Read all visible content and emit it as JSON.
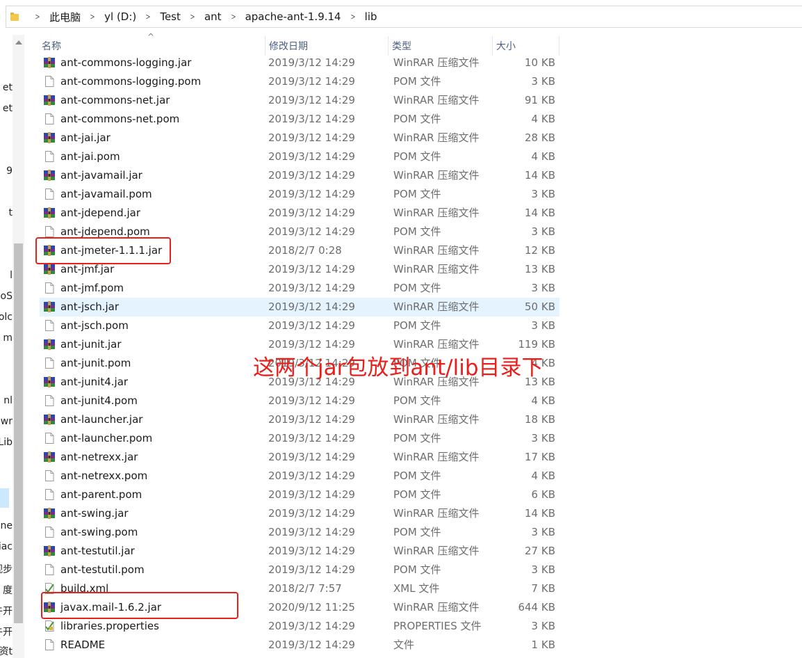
{
  "breadcrumb": [
    "此电脑",
    "yl (D:)",
    "Test",
    "ant",
    "apache-ant-1.9.14",
    "lib"
  ],
  "nav_fragments": [
    "et",
    "et",
    "9",
    "t",
    "l",
    "oS",
    "olc",
    "m",
    "nl",
    "wr",
    "Lib",
    "ne",
    "iac",
    "视步",
    "度",
    "牛开",
    "牛开",
    "资t"
  ],
  "columns": {
    "name": "名称",
    "date": "修改日期",
    "type": "类型",
    "size": "大小"
  },
  "files": [
    {
      "name": "ant-commons-logging.jar",
      "date": "2019/3/12 14:29",
      "type": "WinRAR 压缩文件",
      "size": "10 KB",
      "icon": "winrar-archive-icon"
    },
    {
      "name": "ant-commons-logging.pom",
      "date": "2019/3/12 14:29",
      "type": "POM 文件",
      "size": "3 KB",
      "icon": "generic-file-icon"
    },
    {
      "name": "ant-commons-net.jar",
      "date": "2019/3/12 14:29",
      "type": "WinRAR 压缩文件",
      "size": "91 KB",
      "icon": "winrar-archive-icon"
    },
    {
      "name": "ant-commons-net.pom",
      "date": "2019/3/12 14:29",
      "type": "POM 文件",
      "size": "4 KB",
      "icon": "generic-file-icon"
    },
    {
      "name": "ant-jai.jar",
      "date": "2019/3/12 14:29",
      "type": "WinRAR 压缩文件",
      "size": "28 KB",
      "icon": "winrar-archive-icon"
    },
    {
      "name": "ant-jai.pom",
      "date": "2019/3/12 14:29",
      "type": "POM 文件",
      "size": "4 KB",
      "icon": "generic-file-icon"
    },
    {
      "name": "ant-javamail.jar",
      "date": "2019/3/12 14:29",
      "type": "WinRAR 压缩文件",
      "size": "14 KB",
      "icon": "winrar-archive-icon"
    },
    {
      "name": "ant-javamail.pom",
      "date": "2019/3/12 14:29",
      "type": "POM 文件",
      "size": "3 KB",
      "icon": "generic-file-icon"
    },
    {
      "name": "ant-jdepend.jar",
      "date": "2019/3/12 14:29",
      "type": "WinRAR 压缩文件",
      "size": "14 KB",
      "icon": "winrar-archive-icon"
    },
    {
      "name": "ant-jdepend.pom",
      "date": "2019/3/12 14:29",
      "type": "POM 文件",
      "size": "3 KB",
      "icon": "generic-file-icon"
    },
    {
      "name": "ant-jmeter-1.1.1.jar",
      "date": "2018/2/7 0:28",
      "type": "WinRAR 压缩文件",
      "size": "12 KB",
      "icon": "winrar-archive-icon"
    },
    {
      "name": "ant-jmf.jar",
      "date": "2019/3/12 14:29",
      "type": "WinRAR 压缩文件",
      "size": "13 KB",
      "icon": "winrar-archive-icon"
    },
    {
      "name": "ant-jmf.pom",
      "date": "2019/3/12 14:29",
      "type": "POM 文件",
      "size": "3 KB",
      "icon": "generic-file-icon"
    },
    {
      "name": "ant-jsch.jar",
      "date": "2019/3/12 14:29",
      "type": "WinRAR 压缩文件",
      "size": "50 KB",
      "icon": "winrar-archive-icon"
    },
    {
      "name": "ant-jsch.pom",
      "date": "2019/3/12 14:29",
      "type": "POM 文件",
      "size": "3 KB",
      "icon": "generic-file-icon"
    },
    {
      "name": "ant-junit.jar",
      "date": "2019/3/12 14:29",
      "type": "WinRAR 压缩文件",
      "size": "119 KB",
      "icon": "winrar-archive-icon"
    },
    {
      "name": "ant-junit.pom",
      "date": "2019/3/12 14:29",
      "type": "POM 文件",
      "size": "4 KB",
      "icon": "generic-file-icon"
    },
    {
      "name": "ant-junit4.jar",
      "date": "2019/3/12 14:29",
      "type": "WinRAR 压缩文件",
      "size": "13 KB",
      "icon": "winrar-archive-icon"
    },
    {
      "name": "ant-junit4.pom",
      "date": "2019/3/12 14:29",
      "type": "POM 文件",
      "size": "4 KB",
      "icon": "generic-file-icon"
    },
    {
      "name": "ant-launcher.jar",
      "date": "2019/3/12 14:29",
      "type": "WinRAR 压缩文件",
      "size": "18 KB",
      "icon": "winrar-archive-icon"
    },
    {
      "name": "ant-launcher.pom",
      "date": "2019/3/12 14:29",
      "type": "POM 文件",
      "size": "3 KB",
      "icon": "generic-file-icon"
    },
    {
      "name": "ant-netrexx.jar",
      "date": "2019/3/12 14:29",
      "type": "WinRAR 压缩文件",
      "size": "17 KB",
      "icon": "winrar-archive-icon"
    },
    {
      "name": "ant-netrexx.pom",
      "date": "2019/3/12 14:29",
      "type": "POM 文件",
      "size": "4 KB",
      "icon": "generic-file-icon"
    },
    {
      "name": "ant-parent.pom",
      "date": "2019/3/12 14:29",
      "type": "POM 文件",
      "size": "6 KB",
      "icon": "generic-file-icon"
    },
    {
      "name": "ant-swing.jar",
      "date": "2019/3/12 14:29",
      "type": "WinRAR 压缩文件",
      "size": "14 KB",
      "icon": "winrar-archive-icon"
    },
    {
      "name": "ant-swing.pom",
      "date": "2019/3/12 14:29",
      "type": "POM 文件",
      "size": "3 KB",
      "icon": "generic-file-icon"
    },
    {
      "name": "ant-testutil.jar",
      "date": "2019/3/12 14:29",
      "type": "WinRAR 压缩文件",
      "size": "27 KB",
      "icon": "winrar-archive-icon"
    },
    {
      "name": "ant-testutil.pom",
      "date": "2019/3/12 14:29",
      "type": "POM 文件",
      "size": "3 KB",
      "icon": "generic-file-icon"
    },
    {
      "name": "build.xml",
      "date": "2018/2/7 7:57",
      "type": "XML 文件",
      "size": "7 KB",
      "icon": "xml-file-icon"
    },
    {
      "name": "javax.mail-1.6.2.jar",
      "date": "2020/9/12 11:25",
      "type": "WinRAR 压缩文件",
      "size": "644 KB",
      "icon": "winrar-archive-icon"
    },
    {
      "name": "libraries.properties",
      "date": "2019/3/12 14:29",
      "type": "PROPERTIES 文件",
      "size": "3 KB",
      "icon": "properties-file-icon"
    },
    {
      "name": "README",
      "date": "2019/3/12 14:29",
      "type": "文件",
      "size": "1 KB",
      "icon": "generic-file-icon"
    }
  ],
  "hovered_file": "ant-jsch.jar",
  "highlighted_files": [
    "ant-jmeter-1.1.1.jar",
    "javax.mail-1.6.2.jar"
  ],
  "annotation": "这两个jar包放到ant/lib目录下",
  "colors": {
    "annotation": "#e8201c",
    "hover": "#e5f3ff",
    "header_text": "#4d6082"
  }
}
